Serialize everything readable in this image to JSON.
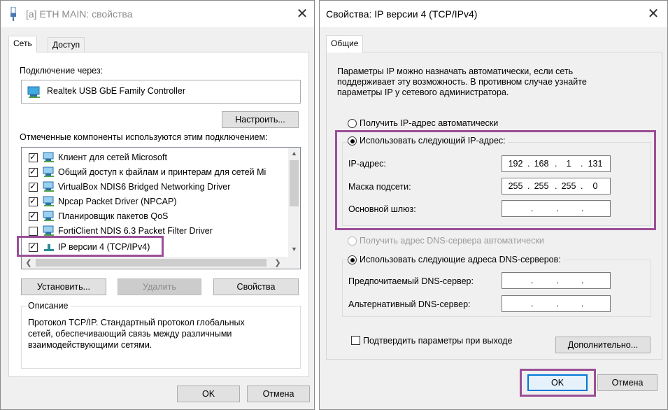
{
  "left_dialog": {
    "title": "[a] ETH MAIN: свойства",
    "tabs": [
      "Сеть",
      "Доступ"
    ],
    "connect_via_label": "Подключение через:",
    "adapter_name": "Realtek USB GbE Family Controller",
    "configure_button": "Настроить...",
    "components_label": "Отмеченные компоненты используются этим подключением:",
    "components": [
      {
        "label": "Клиент для сетей Microsoft",
        "checked": true
      },
      {
        "label": "Общий доступ к файлам и принтерам для сетей Mi",
        "checked": true
      },
      {
        "label": "VirtualBox NDIS6 Bridged Networking Driver",
        "checked": true
      },
      {
        "label": "Npcap Packet Driver (NPCAP)",
        "checked": true
      },
      {
        "label": "Планировщик пакетов QoS",
        "checked": true
      },
      {
        "label": "FortiClient NDIS 6.3 Packet Filter Driver",
        "checked": false
      },
      {
        "label": "IP версии 4 (TCP/IPv4)",
        "checked": true
      }
    ],
    "install_button": "Установить...",
    "remove_button": "Удалить",
    "properties_button": "Свойства",
    "description_title": "Описание",
    "description_text": [
      "Протокол TCP/IP. Стандартный протокол глобальных",
      "сетей, обеспечивающий связь между различными",
      "взаимодействующими сетями."
    ],
    "ok_button": "OK",
    "cancel_button": "Отмена"
  },
  "right_dialog": {
    "title": "Свойства: IP версии 4 (TCP/IPv4)",
    "tab": "Общие",
    "intro": [
      "Параметры IP можно назначать автоматически, если сеть",
      "поддерживает эту возможность. В противном случае узнайте",
      "параметры IP у сетевого администратора."
    ],
    "auto_ip_label": "Получить IP-адрес автоматически",
    "manual_ip_label": "Использовать следующий IP-адрес:",
    "ip_address_label": "IP-адрес:",
    "ip_address": [
      "192",
      "168",
      "1",
      "131"
    ],
    "subnet_mask_label": "Маска подсети:",
    "subnet_mask": [
      "255",
      "255",
      "255",
      "0"
    ],
    "gateway_label": "Основной шлюз:",
    "gateway": [
      "",
      "",
      "",
      ""
    ],
    "auto_dns_label": "Получить адрес DNS-сервера автоматически",
    "manual_dns_label": "Использовать следующие адреса DNS-серверов:",
    "preferred_dns_label": "Предпочитаемый DNS-сервер:",
    "preferred_dns": [
      "",
      "",
      "",
      ""
    ],
    "alternate_dns_label": "Альтернативный DNS-сервер:",
    "alternate_dns": [
      "",
      "",
      "",
      ""
    ],
    "validate_label": "Подтвердить параметры при выходе",
    "advanced_button": "Дополнительно...",
    "ok_button": "OK",
    "cancel_button": "Отмена"
  },
  "colors": {
    "highlight": "#9b4f96",
    "focus": "#0078d7"
  }
}
